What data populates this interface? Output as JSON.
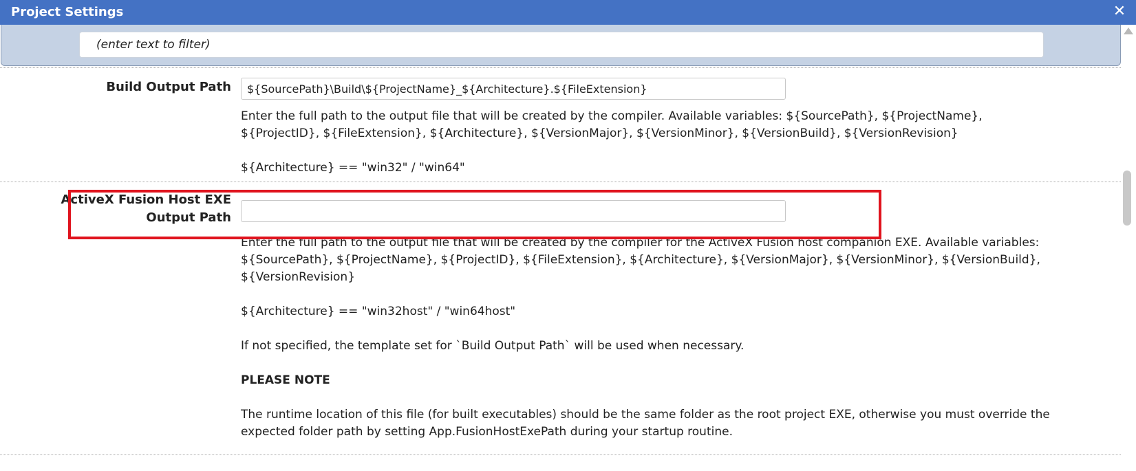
{
  "window": {
    "title": "Project Settings",
    "close_symbol": "✕"
  },
  "filter": {
    "placeholder": "(enter text to filter)",
    "value": ""
  },
  "settings": {
    "build_output_path": {
      "label": "Build Output Path",
      "value": "${SourcePath}\\Build\\${ProjectName}_${Architecture}.${FileExtension}",
      "description": [
        "Enter the full path to the output file that will be created by the compiler. Available variables: ${SourcePath}, ${ProjectName}, ${ProjectID}, ${FileExtension}, ${Architecture}, ${VersionMajor}, ${VersionMinor}, ${VersionBuild}, ${VersionRevision}",
        "${Architecture} == \"win32\" / \"win64\""
      ]
    },
    "activex_host_path": {
      "label_line1": "ActiveX Fusion Host EXE",
      "label_line2": "Output Path",
      "value": "",
      "description": [
        "Enter the full path to the output file that will be created by the compiler for the ActiveX Fusion host companion EXE. Available variables: ${SourcePath}, ${ProjectName}, ${ProjectID}, ${FileExtension}, ${Architecture}, ${VersionMajor}, ${VersionMinor}, ${VersionBuild}, ${VersionRevision}",
        "${Architecture} == \"win32host\" / \"win64host\"",
        "If not specified, the template set for `Build Output Path` will be used when necessary.",
        "PLEASE NOTE",
        "The runtime location of this file (for built executables) should be the same folder as the root project EXE, otherwise you must override the expected folder path by setting App.FusionHostExePath during your startup routine."
      ]
    }
  },
  "colors": {
    "titlebar": "#4472c4",
    "filter_bar": "#c5d2e4",
    "highlight": "#e0141e"
  }
}
